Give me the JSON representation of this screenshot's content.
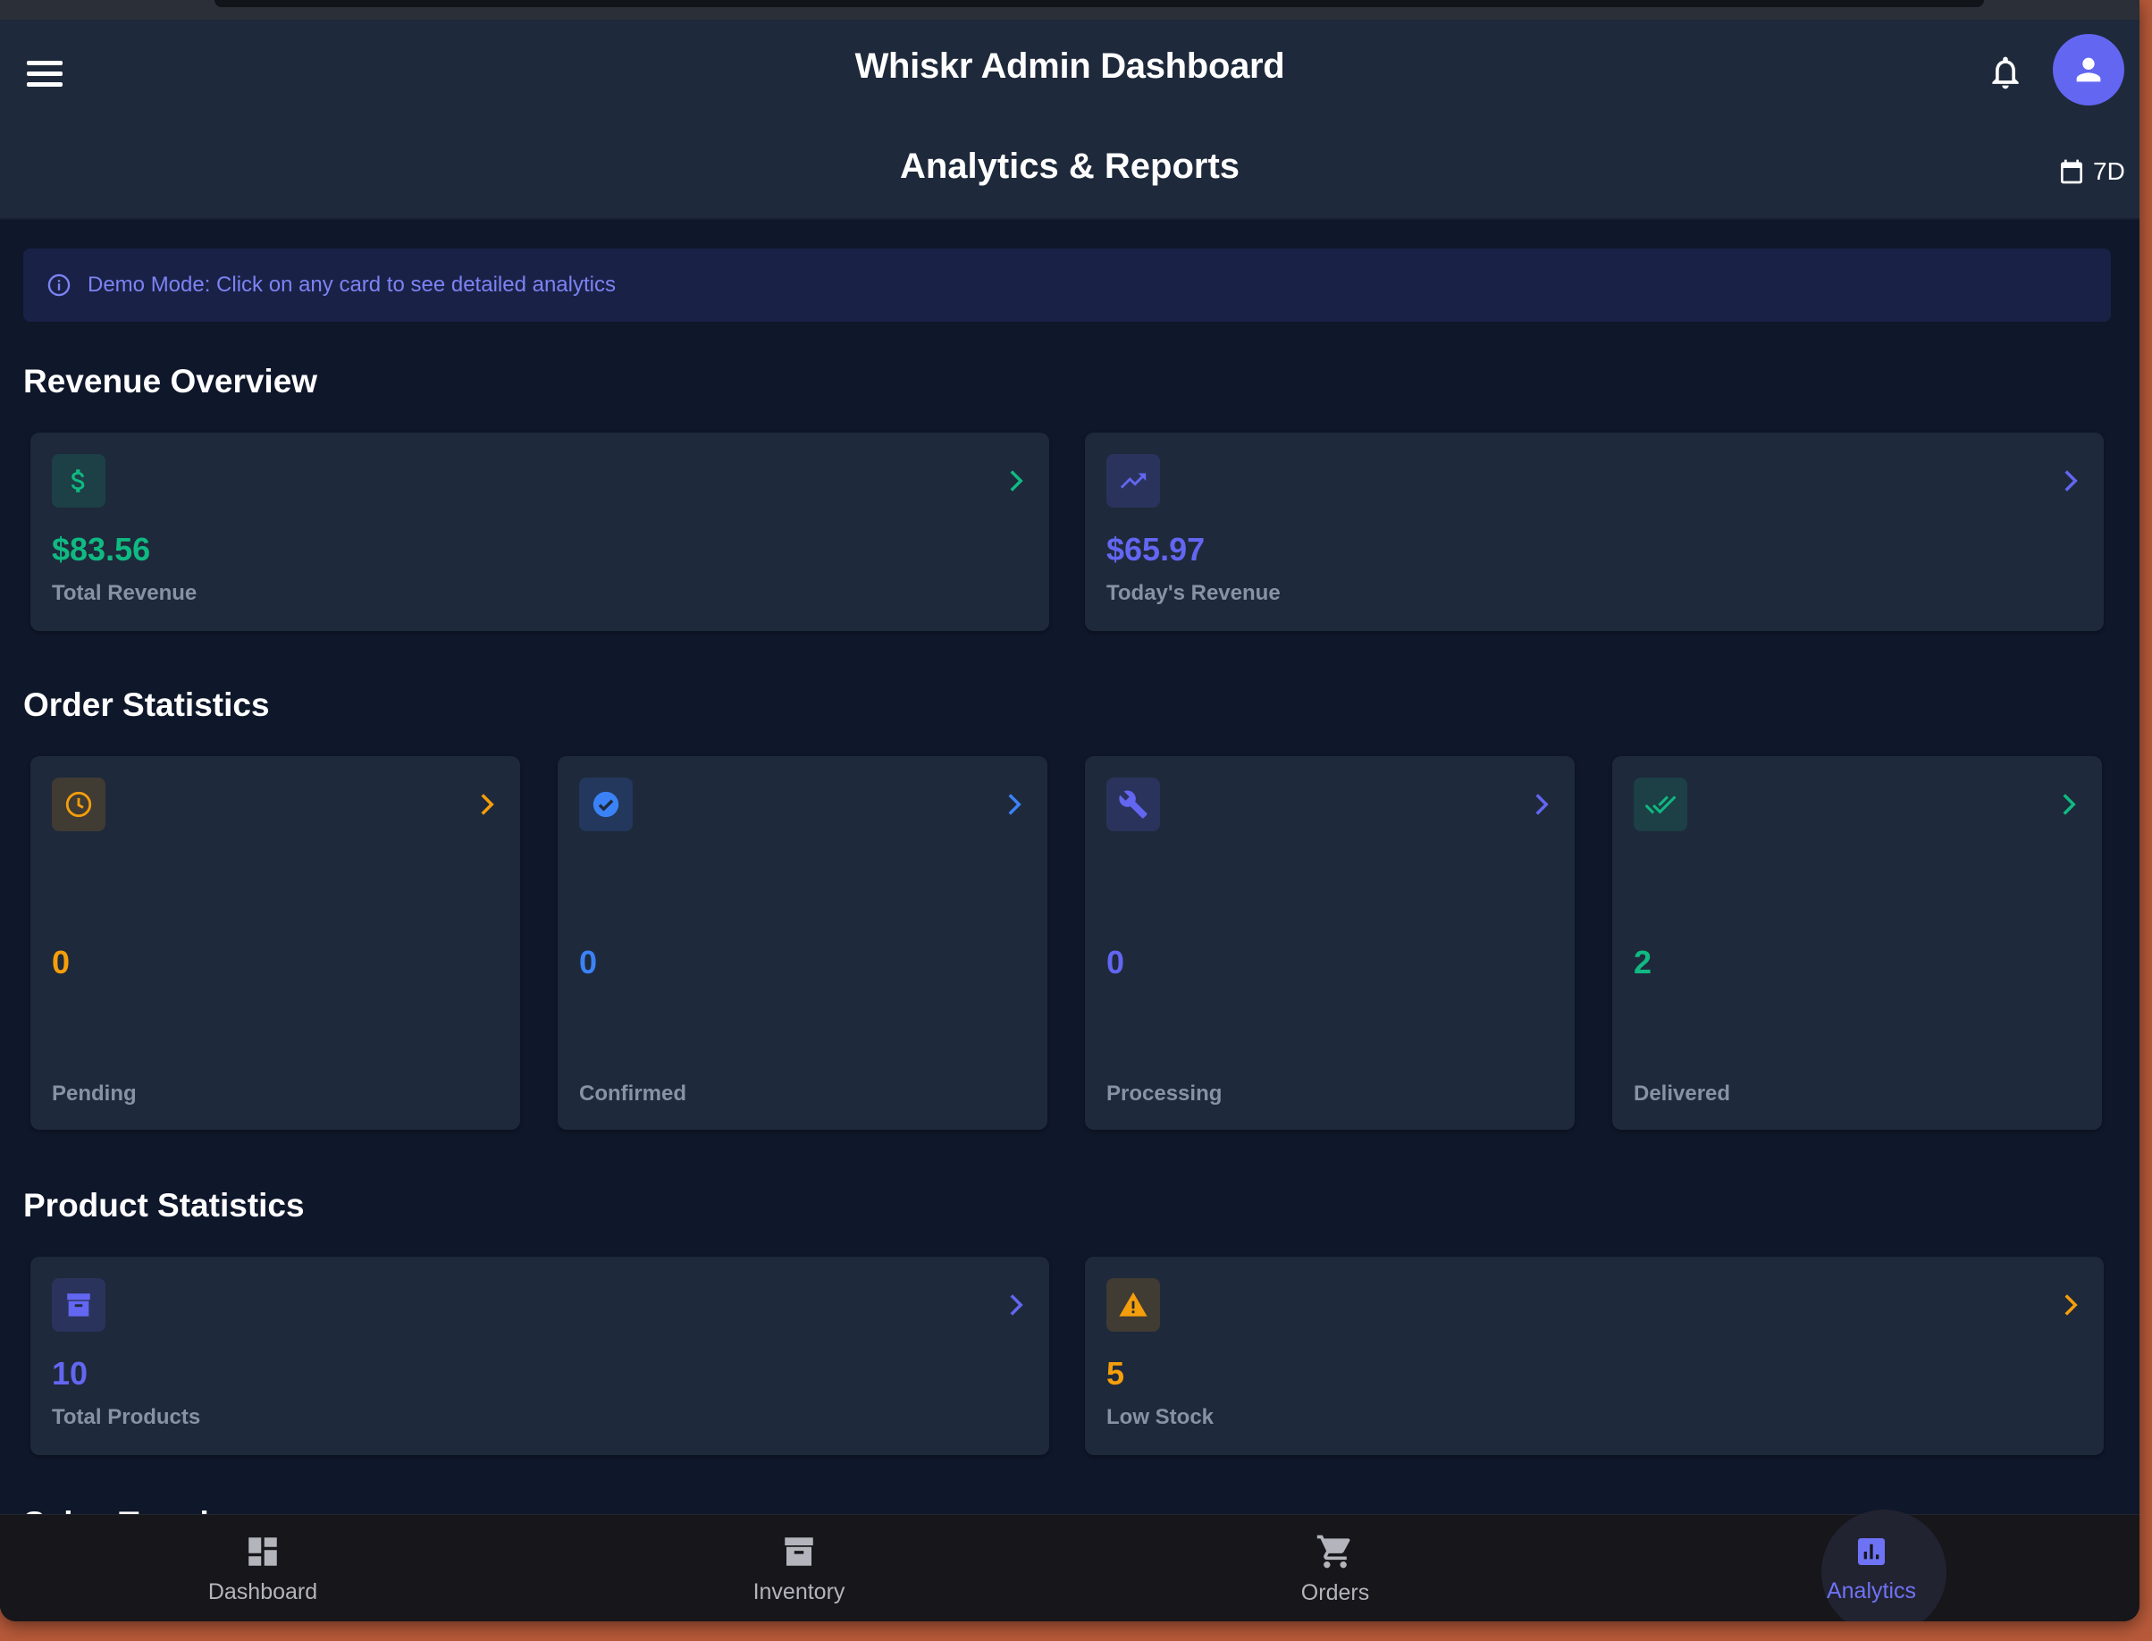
{
  "app": {
    "title": "Whiskr Admin Dashboard"
  },
  "header": {
    "page_title": "Analytics & Reports",
    "range_label": "7D"
  },
  "banner": {
    "text": "Demo Mode: Click on any card to see detailed analytics"
  },
  "revenue": {
    "section_title": "Revenue Overview",
    "cards": [
      {
        "value": "$83.56",
        "label": "Total Revenue",
        "icon": "dollar-icon",
        "color": "#10b981"
      },
      {
        "value": "$65.97",
        "label": "Today's Revenue",
        "icon": "trending-up-icon",
        "color": "#6366f1"
      }
    ]
  },
  "orders": {
    "section_title": "Order Statistics",
    "cards": [
      {
        "value": "0",
        "label": "Pending",
        "icon": "clock-icon",
        "color": "#f59e0b"
      },
      {
        "value": "0",
        "label": "Confirmed",
        "icon": "check-circle-icon",
        "color": "#3b82f6"
      },
      {
        "value": "0",
        "label": "Processing",
        "icon": "wrench-icon",
        "color": "#6366f1"
      },
      {
        "value": "2",
        "label": "Delivered",
        "icon": "double-check-icon",
        "color": "#10b981"
      }
    ]
  },
  "products": {
    "section_title": "Product Statistics",
    "cards": [
      {
        "value": "10",
        "label": "Total Products",
        "icon": "archive-icon",
        "color": "#6366f1"
      },
      {
        "value": "5",
        "label": "Low Stock",
        "icon": "warning-icon",
        "color": "#f59e0b"
      }
    ]
  },
  "partial_section": {
    "title": "Sales Trends"
  },
  "nav": {
    "items": [
      {
        "label": "Dashboard",
        "icon": "dashboard-icon"
      },
      {
        "label": "Inventory",
        "icon": "inventory-icon"
      },
      {
        "label": "Orders",
        "icon": "cart-icon"
      },
      {
        "label": "Analytics",
        "icon": "analytics-icon",
        "active": true
      }
    ],
    "active_color": "#6e73f5",
    "inactive_color": "#b4b4bc"
  }
}
